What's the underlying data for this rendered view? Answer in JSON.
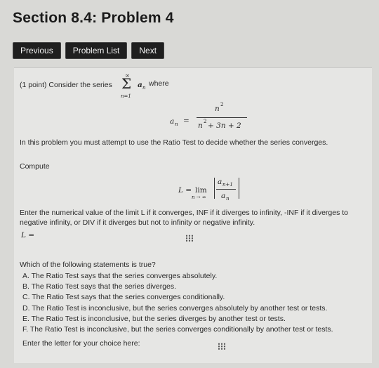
{
  "page": {
    "title": "Section 8.4: Problem 4"
  },
  "nav": {
    "previous": "Previous",
    "problem_list": "Problem List",
    "next": "Next"
  },
  "problem": {
    "intro": "(1 point) Consider the series",
    "where": "where",
    "sum_upper": "∞",
    "sum_lower": "n=1",
    "sum_term": "a",
    "sum_sub": "n",
    "an_lhs": "a",
    "an_lhs_sub": "n",
    "an_eq": "=",
    "an_num": "n",
    "an_num_sup": "2",
    "an_den": "n",
    "an_den_sup": "2",
    "an_den_rest": "+ 3n + 2",
    "ratio_instruction": "In this problem you must attempt to use the Ratio Test to decide whether the series converges.",
    "compute": "Compute",
    "L_lhs": "L =",
    "lim": "lim",
    "lim_sub": "n → ∞",
    "ratio_num": "a",
    "ratio_num_sub": "n+1",
    "ratio_den": "a",
    "ratio_den_sub": "n",
    "enter_limit_line1": "Enter the numerical value of the limit L if it converges, INF if it diverges to infinity, -INF if it diverges to",
    "enter_limit_line2": "negative infinity, or DIV if it diverges but not to infinity or negative infinity.",
    "L_input_label": "L =",
    "question": "Which of the following statements is true?",
    "options": [
      "A. The Ratio Test says that the series converges absolutely.",
      "B. The Ratio Test says that the series diverges.",
      "C. The Ratio Test says that the series converges conditionally.",
      "D. The Ratio Test is inconclusive, but the series converges absolutely by another test or tests.",
      "E. The Ratio Test is inconclusive, but the series diverges by another test or tests.",
      "F. The Ratio Test is inconclusive, but the series converges conditionally by another test or tests."
    ],
    "letter_prompt": "Enter the letter for your choice here:"
  }
}
